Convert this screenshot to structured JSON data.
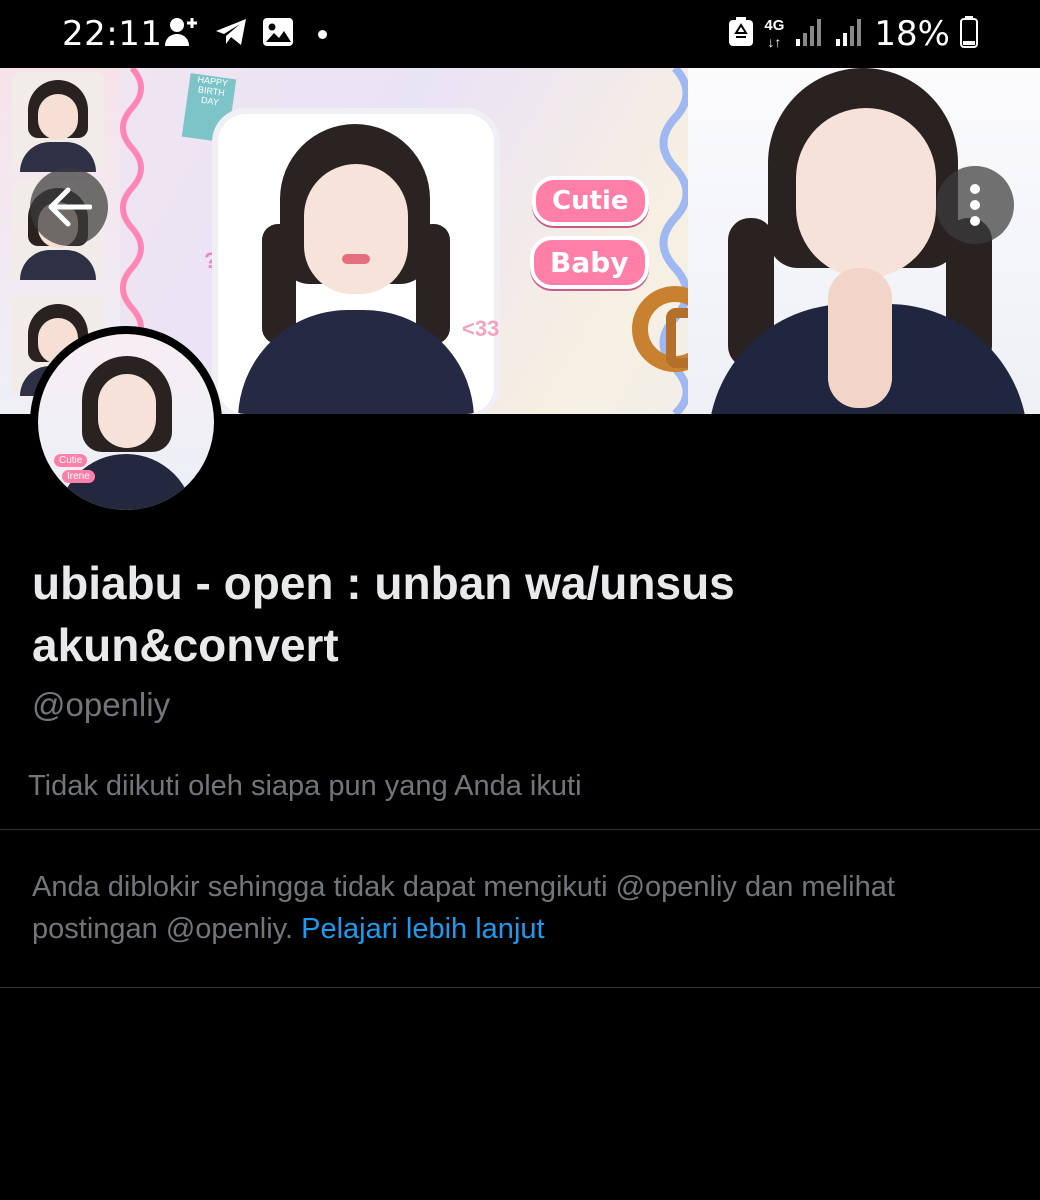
{
  "status_bar": {
    "time": "22:11",
    "network": "4G",
    "battery": "18%",
    "icons_left": [
      "add-contact-icon",
      "telegram-icon",
      "gallery-icon",
      "dot-icon"
    ],
    "icons_right": [
      "recycle-icon",
      "network-icon",
      "signal-icon",
      "signal-icon",
      "battery-icon"
    ]
  },
  "banner": {
    "stickers": {
      "cutie": "Cutie",
      "baby": "Baby",
      "heart_text": "<33",
      "question": "???",
      "birthday": "HAPPY BIRTH DAY"
    }
  },
  "avatar": {
    "tag_top": "Cutie",
    "tag_bottom": "Irene"
  },
  "profile": {
    "display_name": "ubiabu - open : unban wa/unsus akun&convert",
    "handle": "@openliy",
    "followed_by": "Tidak diikuti oleh siapa pun yang Anda ikuti"
  },
  "blocked_notice": {
    "text": "Anda diblokir sehingga tidak dapat mengikuti @openliy dan melihat postingan @openliy.",
    "link": "Pelajari lebih lanjut"
  },
  "colors": {
    "background": "#000000",
    "primary_text": "#e7e9ea",
    "secondary_text": "#71767b",
    "link": "#1d9bf0",
    "divider": "#2f3336"
  }
}
